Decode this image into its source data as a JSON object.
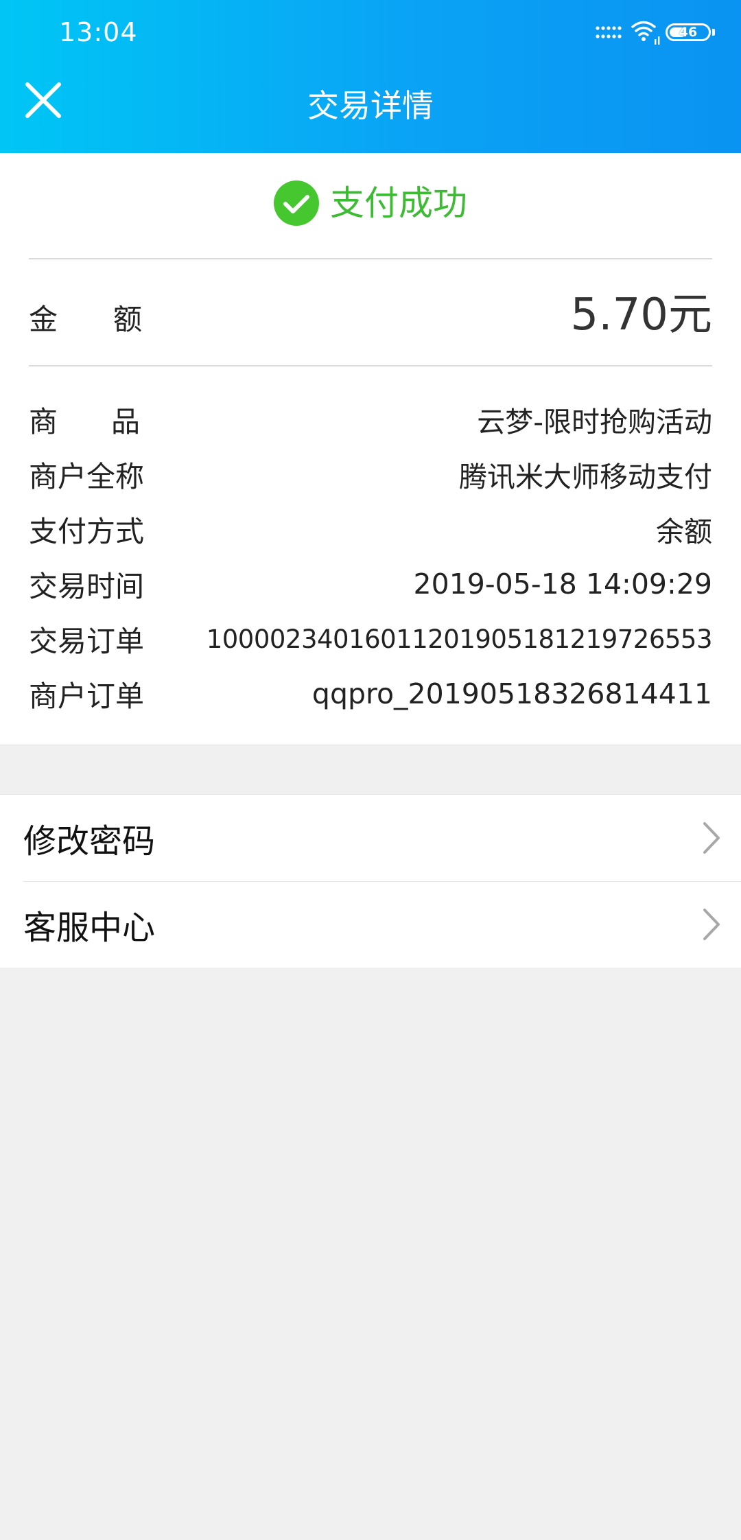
{
  "status_bar": {
    "time": "13:04",
    "battery": "46"
  },
  "nav": {
    "title": "交易详情",
    "close_icon": "close-icon"
  },
  "result": {
    "status_text": "支付成功",
    "status_color": "#3dbb33",
    "icon": "check-circle-icon"
  },
  "amount": {
    "label_chars": [
      "金",
      "额"
    ],
    "value": "5.70元"
  },
  "details": [
    {
      "label": "商　　品",
      "label_chars": [
        "商",
        "品"
      ],
      "value": "云梦-限时抢购活动"
    },
    {
      "label": "商户全称",
      "value": "腾讯米大师移动支付"
    },
    {
      "label": "支付方式",
      "value": "余额"
    },
    {
      "label": "交易时间",
      "value": "2019-05-18 14:09:29"
    },
    {
      "label": "交易订单",
      "value": "10000234016011201905181219726553"
    },
    {
      "label": "商户订单",
      "value": "qqpro_20190518326814411"
    }
  ],
  "menu": [
    {
      "label": "修改密码",
      "icon": "chevron-right-icon"
    },
    {
      "label": "客服中心",
      "icon": "chevron-right-icon"
    }
  ],
  "colors": {
    "header_start": "#00c6f5",
    "header_end": "#0a93f2",
    "success_green": "#3dbb33",
    "page_bg": "#f0f0f0"
  }
}
